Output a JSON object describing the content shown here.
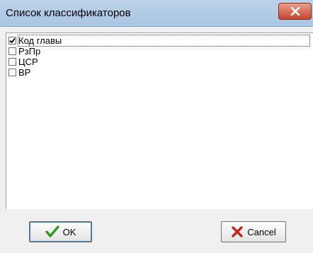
{
  "window": {
    "title": "Список классификаторов",
    "close_icon": "close-x-icon"
  },
  "list": {
    "items": [
      {
        "label": "Код главы",
        "checked": true
      },
      {
        "label": "РзПр",
        "checked": false
      },
      {
        "label": "ЦСР",
        "checked": false
      },
      {
        "label": "ВР",
        "checked": false
      }
    ]
  },
  "buttons": {
    "ok_label": "OK",
    "ok_icon": "green-checkmark-icon",
    "cancel_label": "Cancel",
    "cancel_icon": "red-x-icon"
  },
  "colors": {
    "titlebar": "#a9c5e2",
    "close": "#c8452d",
    "ok_check": "#2e9b1f",
    "cancel_x": "#c0261b"
  }
}
